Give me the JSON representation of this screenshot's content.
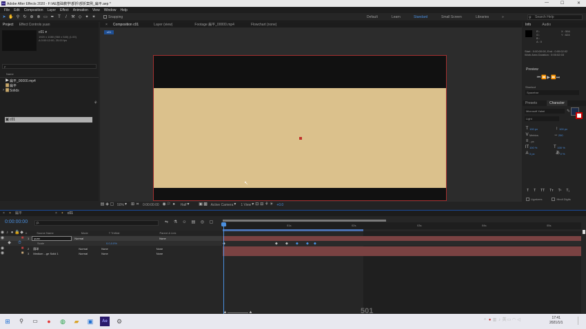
{
  "app": {
    "title": "Adobe After Effects 2020 - F:\\AE基础教学\\部折\\部折案例_扁平.aep *",
    "window_controls": [
      "—",
      "☐",
      "✕"
    ]
  },
  "menu": [
    "File",
    "Edit",
    "Composition",
    "Layer",
    "Effect",
    "Animation",
    "View",
    "Window",
    "Help"
  ],
  "toolbar": {
    "snapping": "Snapping",
    "workspaces": [
      "Default",
      "Learn",
      "Standard",
      "Small Screen",
      "Libraries"
    ],
    "active_workspace": "Standard",
    "search_placeholder": "Search Help"
  },
  "project": {
    "tabs": [
      "Project",
      "Effect Controls yuan"
    ],
    "selected_name": "c01 ▾",
    "selected_info": [
      "1920 x 1080 (960 x 540) (1.00)",
      "Δ 0:00:12:00, 25.00 fps"
    ],
    "search_placeholder": "ρ",
    "column_name": "Name",
    "items": [
      {
        "icon": "play",
        "name": "扁平_00000.mp4"
      },
      {
        "icon": "folder",
        "name": "扁平"
      },
      {
        "icon": "folder",
        "name": "Solids"
      },
      {
        "icon": "comp",
        "name": "c01",
        "selected": true
      }
    ],
    "bpc": "8 bpc"
  },
  "composition": {
    "tabs": [
      "Composition c01",
      "Layer (view)",
      "Footage 扁平_00000.mp4",
      "Flowchart (none)"
    ],
    "sub_tab": "c01",
    "canvas_color": "#dbc18c",
    "bar_color": "#111111",
    "footer": {
      "zoom": "50%",
      "timecode": "0:00:00:00",
      "resolution": "Half",
      "camera": "Active Camera",
      "view": "1 View",
      "plus": "+0.0"
    }
  },
  "info": {
    "tabs": [
      "Info",
      "Audio"
    ],
    "rgba": [
      "R :",
      "G :",
      "B :",
      "A : 0"
    ],
    "xy": [
      "X : 594",
      "Y : 624"
    ],
    "time": [
      "Start : 0:00:00:00, End : 0:00:02:02",
      "Work Area Duration : 0:00:02:03"
    ]
  },
  "preview": {
    "title": "Preview"
  },
  "shortcut": {
    "label": "Shortcut",
    "value": "Spacebar"
  },
  "character": {
    "tabs": [
      "Presets",
      "Character"
    ],
    "font": "Microsoft Yahei",
    "style": "Light",
    "size": "100 px",
    "leading": "100 px",
    "kerning": "Metrics",
    "tracking": "290",
    "stroke": "- px",
    "vscale": "100 %",
    "hscale": "100 %",
    "baseline": "0 px",
    "tsume": "0 %",
    "format": [
      "T",
      "T",
      "TT",
      "Tт",
      "T¹",
      "T₁"
    ],
    "ligatures": "Ligatures",
    "hindi": "Hindi Digits"
  },
  "timeline": {
    "tabs": [
      "扁平",
      "c01"
    ],
    "timecode": "0:00:00:00",
    "search": "ρ.",
    "columns": [
      "#",
      "Source Name",
      "Mode",
      "T TrkMat",
      "Parent & Link"
    ],
    "ruler": [
      "0f",
      "01s",
      "02s",
      "03s",
      "04s",
      "05s"
    ],
    "layers": [
      {
        "num": "1",
        "name": "yuan",
        "mode": "Normal",
        "trkmat": "",
        "parent": "None",
        "color": "#c04040"
      },
      {
        "num": "",
        "name": "Scale",
        "mode": "",
        "trkmat": "",
        "parent": "",
        "value": "0.0,0.0%",
        "color": ""
      },
      {
        "num": "2",
        "name": "圆球",
        "mode": "Normal",
        "trkmat": "None",
        "parent": "None",
        "color": "#c04040"
      },
      {
        "num": "3",
        "name": "Medium ...ge Solid 1",
        "mode": "Normal",
        "trkmat": "None",
        "parent": "None",
        "color": "#c8a878"
      }
    ],
    "watermark": "501"
  },
  "taskbar": {
    "time": "17:41",
    "date": "2021/1/1"
  }
}
